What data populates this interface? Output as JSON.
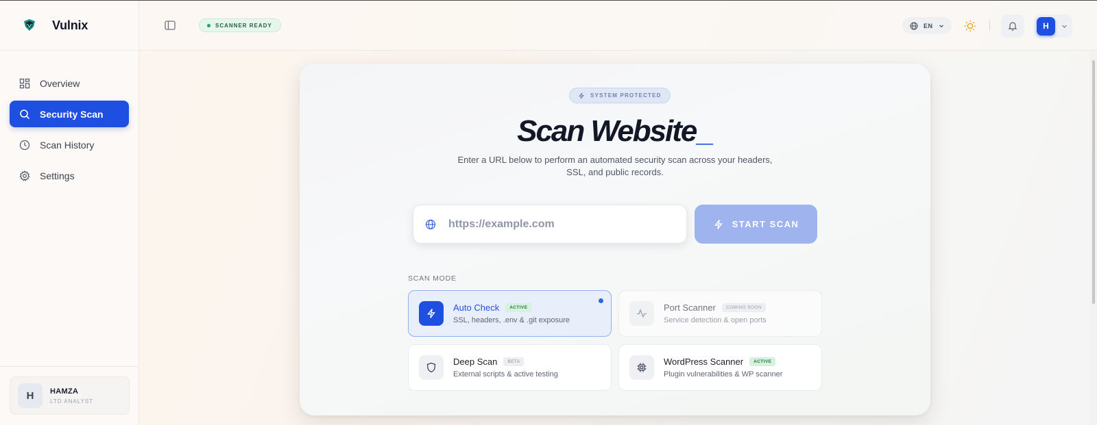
{
  "brand": {
    "name": "Vulnix",
    "logo_icon": "shield-logo-icon"
  },
  "sidebar": {
    "items": [
      {
        "label": "Overview",
        "icon": "grid-icon",
        "active": false
      },
      {
        "label": "Security Scan",
        "icon": "search-icon",
        "active": true
      },
      {
        "label": "Scan History",
        "icon": "clock-icon",
        "active": false
      },
      {
        "label": "Settings",
        "icon": "gear-icon",
        "active": false
      }
    ],
    "user": {
      "initial": "H",
      "name": "HAMZA",
      "role": "LTD ANALYST"
    }
  },
  "topbar": {
    "status": "SCANNER READY",
    "status_color": "#22a35a",
    "language": "EN",
    "profile_initial": "H"
  },
  "scan": {
    "protected_label": "SYSTEM PROTECTED",
    "title": "Scan Website",
    "cursor": "_",
    "subtitle": "Enter a URL below to perform an automated security scan across your headers, SSL, and public records.",
    "url_placeholder": "https://example.com",
    "url_value": "",
    "start_label": "START SCAN",
    "mode_label": "SCAN MODE",
    "modes": [
      {
        "title": "Auto Check",
        "badge": "ACTIVE",
        "desc": "SSL, headers, .env & .git exposure",
        "icon": "bolt-icon",
        "selected": true
      },
      {
        "title": "Port Scanner",
        "badge": "COMING SOON",
        "desc": "Service detection & open ports",
        "icon": "activity-icon",
        "selected": false
      },
      {
        "title": "Deep Scan",
        "badge": "BETA",
        "desc": "External scripts & active testing",
        "icon": "shield-icon",
        "selected": false
      },
      {
        "title": "WordPress Scanner",
        "badge": "ACTIVE",
        "desc": "Plugin vulnerabilities & WP scanner",
        "icon": "chip-icon",
        "selected": false
      }
    ]
  },
  "colors": {
    "accent": "#1e4fe0",
    "start_button": "#9fb3ef",
    "active_badge": "#d6f2df"
  }
}
